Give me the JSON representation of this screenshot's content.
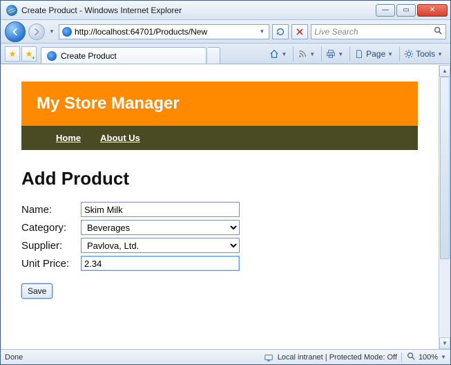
{
  "window": {
    "title": "Create Product - Windows Internet Explorer"
  },
  "address": {
    "url": "http://localhost:64701/Products/New"
  },
  "search": {
    "placeholder": "Live Search"
  },
  "tab": {
    "title": "Create Product"
  },
  "toolbar": {
    "page_label": "Page",
    "tools_label": "Tools"
  },
  "site": {
    "banner_title": "My Store Manager",
    "nav": [
      "Home",
      "About Us"
    ]
  },
  "page": {
    "heading": "Add Product",
    "labels": {
      "name": "Name:",
      "category": "Category:",
      "supplier": "Supplier:",
      "unit_price": "Unit Price:"
    },
    "values": {
      "name": "Skim Milk",
      "category": "Beverages",
      "supplier": "Pavlova, Ltd.",
      "unit_price": "2.34"
    },
    "save_label": "Save"
  },
  "status": {
    "left": "Done",
    "security": "Local intranet | Protected Mode: Off",
    "zoom": "100%"
  }
}
